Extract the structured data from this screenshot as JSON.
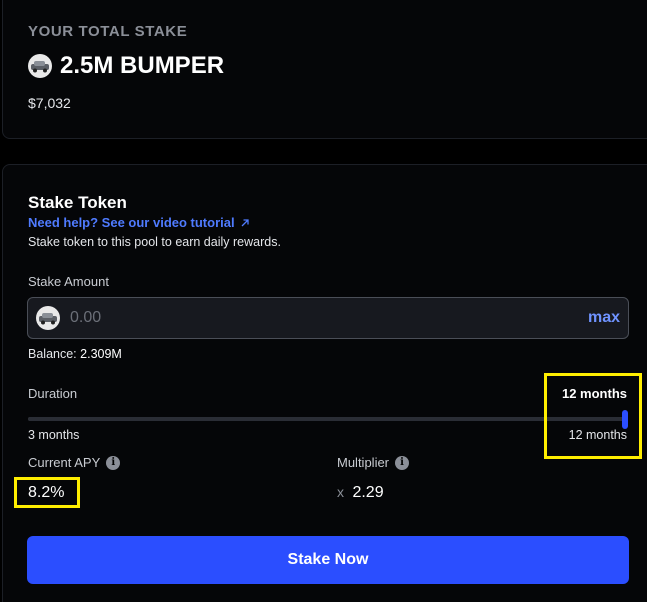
{
  "summary": {
    "label": "YOUR TOTAL STAKE",
    "amount": "2.5M BUMPER",
    "usd": "$7,032",
    "token_icon": "car-token-icon"
  },
  "stake_form": {
    "title": "Stake Token",
    "help_link": "Need help? See our video tutorial",
    "description": "Stake token to this pool to earn daily rewards.",
    "amount_label": "Stake Amount",
    "amount_placeholder": "0.00",
    "max_label": "max",
    "balance_label": "Balance:",
    "balance_value": "2.309M",
    "duration_label": "Duration",
    "duration_selected": "12 months",
    "duration_min": "3 months",
    "duration_max": "12 months",
    "duration_fraction": 1.0,
    "apy_label": "Current APY",
    "apy_value": "8.2%",
    "multiplier_label": "Multiplier",
    "multiplier_prefix": "x",
    "multiplier_value": "2.29",
    "submit_label": "Stake Now"
  },
  "colors": {
    "accent": "#2b4eff",
    "link": "#4f7bff",
    "highlight": "#ffee00",
    "background": "#000000"
  }
}
